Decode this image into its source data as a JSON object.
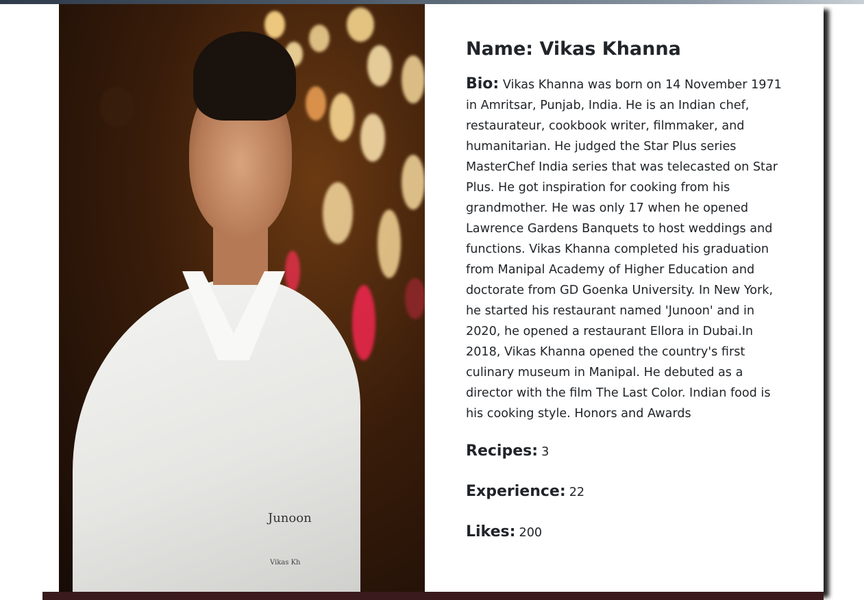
{
  "chef": {
    "name_label": "Name:",
    "name": "Vikas Khanna",
    "bio_label": "Bio:",
    "bio": "Vikas Khanna was born on 14 November 1971 in Amritsar, Punjab, India. He is an Indian chef, restaurateur, cookbook writer, filmmaker, and humanitarian. He judged the Star Plus series MasterChef India series that was telecasted on Star Plus. He got inspiration for cooking from his grandmother. He was only 17 when he opened Lawrence Gardens Banquets to host weddings and functions. Vikas Khanna completed his graduation from Manipal Academy of Higher Education and doctorate from GD Goenka University. In New York, he started his restaurant named 'Junoon' and in 2020, he opened a restaurant Ellora in Dubai.In 2018, Vikas Khanna opened the country's first culinary museum in Manipal. He debuted as a director with the film The Last Color. Indian food is his cooking style. Honors and Awards",
    "recipes_label": "Recipes:",
    "recipes": "3",
    "experience_label": "Experience:",
    "experience": "22",
    "likes_label": "Likes:",
    "likes": "200"
  },
  "photo": {
    "icon": "chef-portrait-photo",
    "coat_text": "Junoon",
    "coat_subtext": "Vikas Kh"
  },
  "colors": {
    "text": "#212529",
    "bottom_bar": "#3a1a1c",
    "top_bar": "#2f3b4a"
  }
}
